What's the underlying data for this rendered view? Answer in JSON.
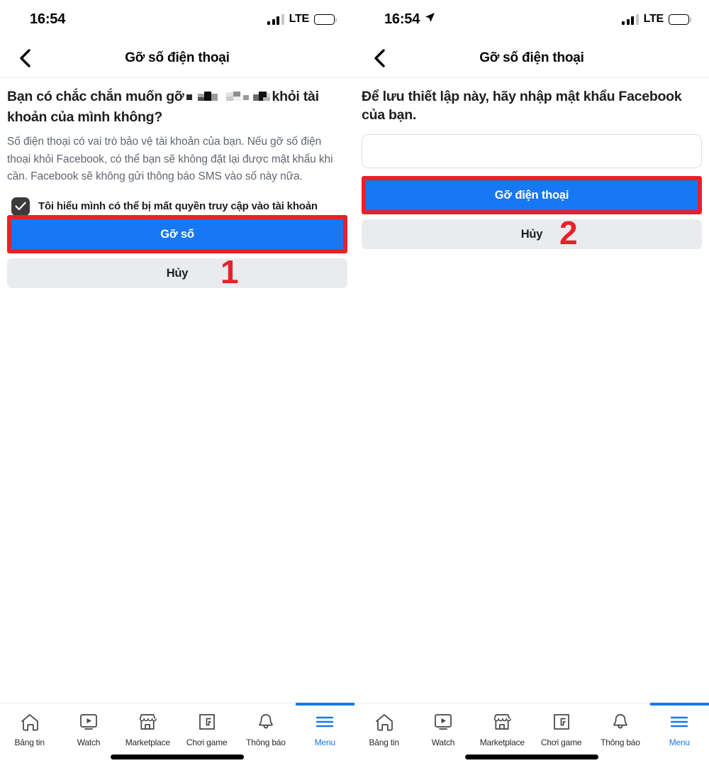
{
  "panels": [
    {
      "id": "panel-confirm-remove",
      "status_bar": {
        "time": "16:54",
        "has_location_arrow": false,
        "carrier": "LTE",
        "signal_icon": "signal-bars-icon",
        "battery_icon": "battery-icon"
      },
      "nav": {
        "back_icon": "chevron-left-icon",
        "title": "Gỡ số điện thoại"
      },
      "headline_before": "Bạn có chắc chắn muốn gỡ",
      "headline_redacted": "redacted-phone-number",
      "headline_after": "khỏi tài khoản của mình không?",
      "body": "Số điện thoại có vai trò bảo vệ tài khoản của bạn. Nếu gỡ số điện thoại khỏi Facebook, có thể bạn sẽ không đặt lại được mật khẩu khi cần. Facebook sẽ không gửi thông báo SMS vào số này nữa.",
      "checkbox": {
        "checked": true,
        "icon": "checkmark-icon",
        "label": "Tôi hiểu mình có thể bị mất quyền truy cập vào tài khoản"
      },
      "primary_button": "Gỡ số",
      "secondary_button": "Hủy",
      "step_number": "1"
    },
    {
      "id": "panel-password-confirm",
      "status_bar": {
        "time": "16:54",
        "has_location_arrow": true,
        "location_icon": "location-arrow-icon",
        "carrier": "LTE",
        "signal_icon": "signal-bars-icon",
        "battery_icon": "battery-icon"
      },
      "nav": {
        "back_icon": "chevron-left-icon",
        "title": "Gỡ số điện thoại"
      },
      "headline": "Để lưu thiết lập này, hãy nhập mật khẩu Facebook của bạn.",
      "password_field": {
        "value": "",
        "placeholder": ""
      },
      "primary_button": "Gỡ điện thoại",
      "secondary_button": "Hủy",
      "step_number": "2"
    }
  ],
  "tabbar": {
    "items": [
      {
        "label": "Bảng tin",
        "icon": "home-icon",
        "active": false
      },
      {
        "label": "Watch",
        "icon": "watch-play-icon",
        "active": false
      },
      {
        "label": "Marketplace",
        "icon": "marketplace-icon",
        "active": false
      },
      {
        "label": "Chơi game",
        "icon": "gaming-icon",
        "active": false
      },
      {
        "label": "Thông báo",
        "icon": "bell-icon",
        "active": false
      },
      {
        "label": "Menu",
        "icon": "hamburger-icon",
        "active": true
      }
    ]
  },
  "colors": {
    "brand_blue": "#1877f2",
    "annotation_red": "#e8202a",
    "secondary_button_bg": "#e9ebee",
    "body_text": "#606770"
  }
}
